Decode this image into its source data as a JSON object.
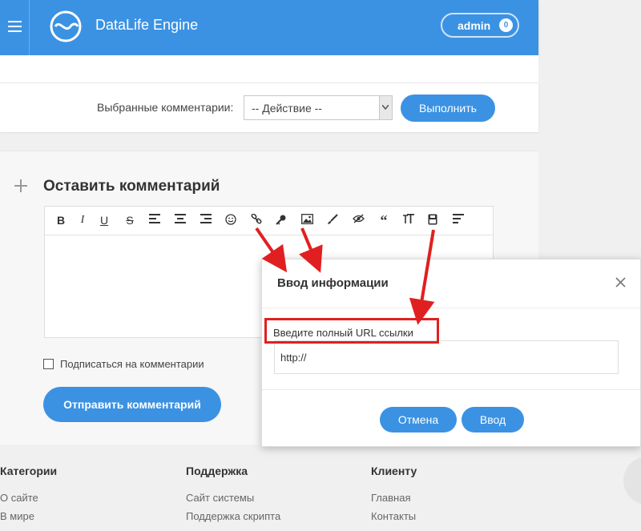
{
  "header": {
    "brand": "DataLife Engine",
    "user": "admin",
    "notifications": "0"
  },
  "actions": {
    "label": "Выбранные комментарии:",
    "select_value": "-- Действие --",
    "execute_label": "Выполнить"
  },
  "comment": {
    "title": "Оставить комментарий",
    "toolbar": [
      "bold",
      "italic",
      "underline",
      "strike",
      "align-left",
      "align-center",
      "align-right",
      "smiley",
      "link",
      "key",
      "image",
      "brush",
      "hide",
      "quote",
      "font-size",
      "video",
      "more"
    ],
    "subscribe_label": "Подписаться на комментарии",
    "send_label": "Отправить комментарий"
  },
  "footer": {
    "columns": [
      {
        "title": "Категории",
        "links": [
          "О сайте",
          "В мире"
        ]
      },
      {
        "title": "Поддержка",
        "links": [
          "Сайт системы",
          "Поддержка скрипта"
        ]
      },
      {
        "title": "Клиенту",
        "links": [
          "Главная",
          "Контакты"
        ]
      }
    ]
  },
  "dialog": {
    "title": "Ввод информации",
    "prompt": "Введите полный URL ссылки",
    "input_value": "http://",
    "cancel_label": "Отмена",
    "ok_label": "Ввод"
  },
  "colors": {
    "accent": "#3b92e3",
    "annotation": "#e02020"
  }
}
